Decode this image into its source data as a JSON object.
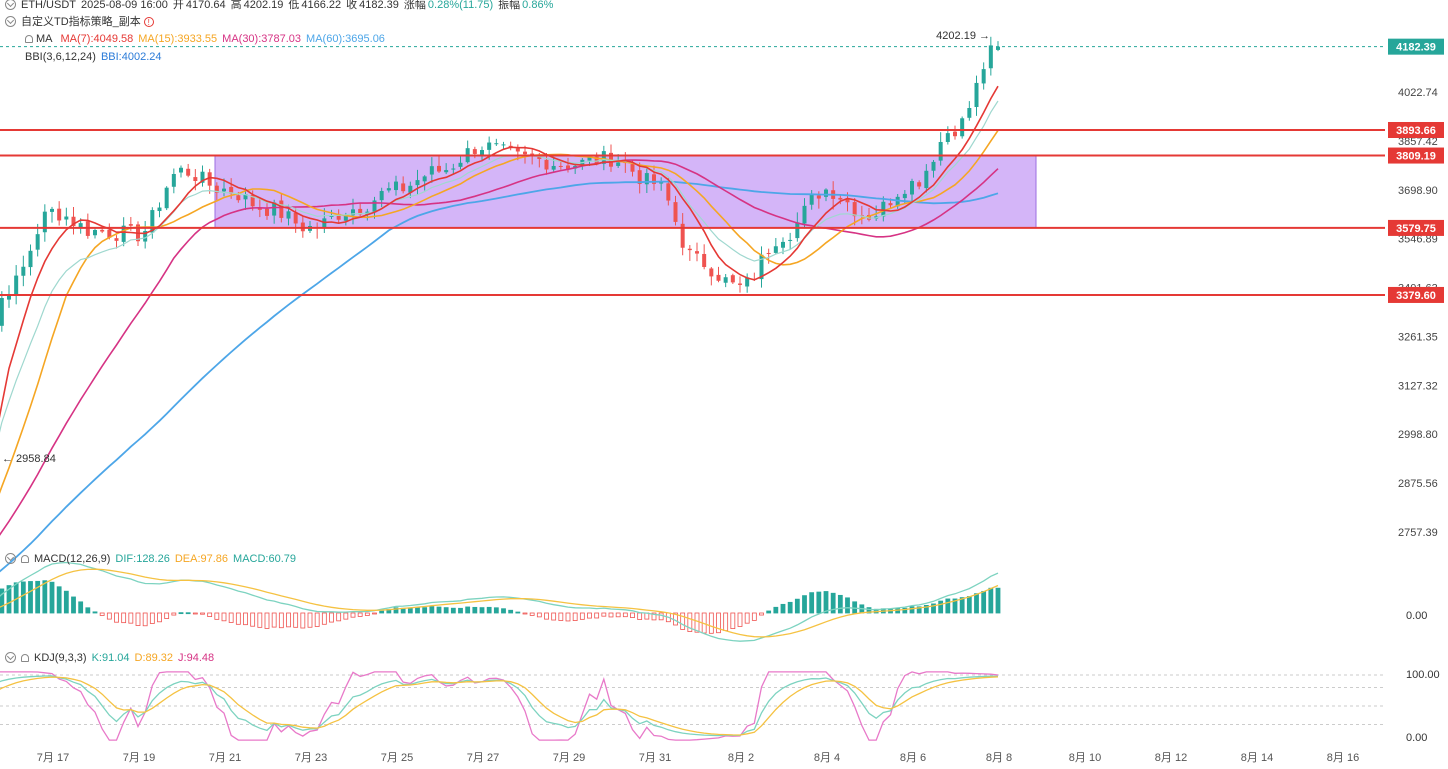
{
  "header": {
    "symbol": "ETH/USDT",
    "datetime": "2025-08-09 16:00",
    "open_label": "开",
    "open": "4170.64",
    "high_label": "高",
    "high": "4202.19",
    "low_label": "低",
    "low": "4166.22",
    "close_label": "收",
    "close": "4182.39",
    "change_label": "涨幅",
    "change": "0.28%(11.75)",
    "amp_label": "振幅",
    "amp": "0.86%",
    "strategy": "自定义TD指标策略_副本",
    "warn_glyph": "!"
  },
  "indicators": {
    "ma_title": "MA",
    "ma7": "MA(7):4049.58",
    "ma15": "MA(15):3933.55",
    "ma30": "MA(30):3787.03",
    "ma60": "MA(60):3695.06",
    "bbi_title": "BBI(3,6,12,24)",
    "bbi": "BBI:4002.24",
    "macd_title": "MACD(12,26,9)",
    "dif": "DIF:128.26",
    "dea": "DEA:97.86",
    "macd": "MACD:60.79",
    "kdj_title": "KDJ(9,3,3)",
    "k": "K:91.04",
    "d": "D:89.32",
    "j": "J:94.48"
  },
  "colors": {
    "up": "#26a69a",
    "down": "#ef5350",
    "ma7": "#e53935",
    "ma15": "#f5a623",
    "ma30": "#d63384",
    "ma60": "#4da6e8",
    "bbi": "#2b7bd8",
    "level": "#e53935",
    "box": "#c59cf5",
    "current": "#26a69a",
    "dif": "#7dd3c0",
    "dea": "#f5c242",
    "kline": "#7dd3c0",
    "dline": "#f5c242",
    "jline": "#e879c9"
  },
  "chart_data": {
    "type": "candlestick",
    "instrument": "ETH/USDT",
    "interval": "4h",
    "x_ticks": [
      "7月 17",
      "7月 19",
      "7月 21",
      "7月 23",
      "7月 25",
      "7月 27",
      "7月 29",
      "7月 31",
      "8月 2",
      "8月 4",
      "8月 6",
      "8月 8",
      "8月 10",
      "8月 12",
      "8月 14",
      "8月 16"
    ],
    "y_ticks": [
      "4022.74",
      "3857.42",
      "3698.90",
      "3546.89",
      "3401.63",
      "3261.35",
      "3127.32",
      "2998.80",
      "2875.56",
      "2757.39"
    ],
    "ylim": [
      2700,
      4260
    ],
    "horizontal_levels": [
      "3893.66",
      "3809.19",
      "3579.75",
      "3379.60"
    ],
    "current_price": "4182.39",
    "annotations": {
      "high": "4202.19",
      "low": "2958.84"
    },
    "range_box": {
      "from": "7月 21",
      "to": "8月 9",
      "top": 3809.19,
      "bottom": 3579.75
    },
    "anchors": [
      [
        "7月 16",
        2958
      ],
      [
        "7月 17",
        3400
      ],
      [
        "7月 18",
        3630
      ],
      [
        "7月 19",
        3570
      ],
      [
        "7月 20",
        3560
      ],
      [
        "7月 21",
        3760
      ],
      [
        "7月 22",
        3700
      ],
      [
        "7月 23",
        3640
      ],
      [
        "7月 24",
        3580
      ],
      [
        "7月 25",
        3640
      ],
      [
        "7月 26",
        3700
      ],
      [
        "7月 27",
        3760
      ],
      [
        "7月 28",
        3840
      ],
      [
        "7月 29",
        3800
      ],
      [
        "7月 30",
        3780
      ],
      [
        "7月 31",
        3800
      ],
      [
        "8月 1",
        3720
      ],
      [
        "8月 2",
        3480
      ],
      [
        "8月 3",
        3400
      ],
      [
        "8月 4",
        3560
      ],
      [
        "8月 5",
        3700
      ],
      [
        "8月 6",
        3620
      ],
      [
        "8月 7",
        3720
      ],
      [
        "8月 8",
        3900
      ],
      [
        "8月 9",
        4182
      ]
    ],
    "ma_note": "MA(7), MA(15), MA(30), MA(60), BBI overlays",
    "macd_ytick": "0.00",
    "kdj_yticks": [
      "100.00",
      "0.00"
    ]
  }
}
